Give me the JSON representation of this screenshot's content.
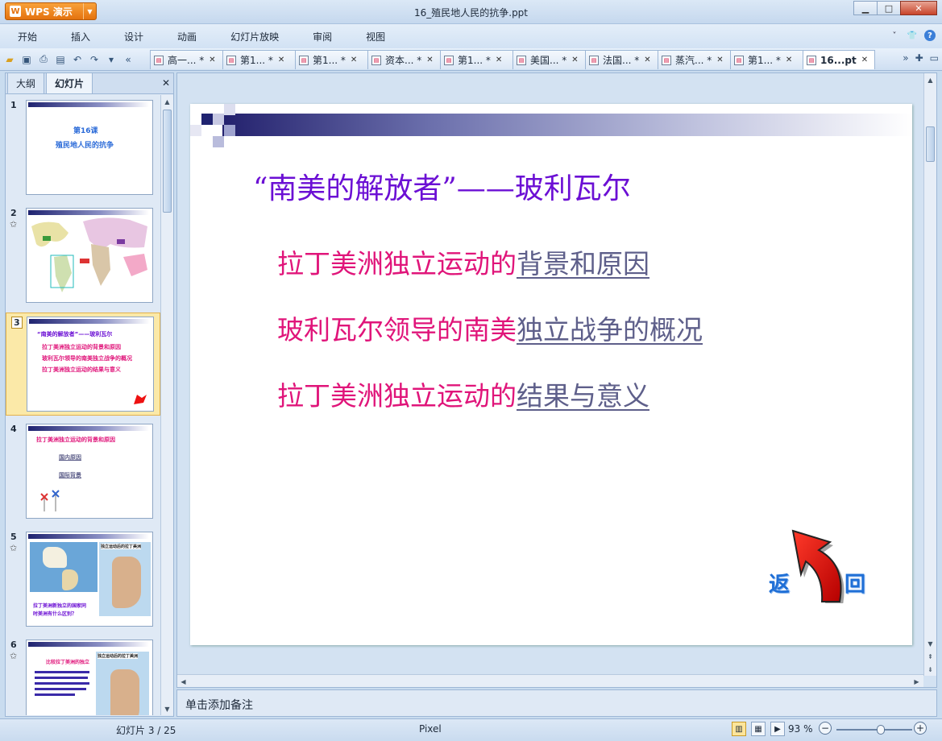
{
  "app": {
    "name": "WPS 演示",
    "window_title": "16_殖民地人民的抗争.ppt"
  },
  "menu": [
    "开始",
    "插入",
    "设计",
    "动画",
    "幻灯片放映",
    "审阅",
    "视图"
  ],
  "doc_tabs": [
    {
      "label": "高一... *",
      "active": false
    },
    {
      "label": "第1... *",
      "active": false
    },
    {
      "label": "第1... *",
      "active": false
    },
    {
      "label": "资本... *",
      "active": false
    },
    {
      "label": "第1... *",
      "active": false
    },
    {
      "label": "美国... *",
      "active": false
    },
    {
      "label": "法国... *",
      "active": false
    },
    {
      "label": "蒸汽... *",
      "active": false
    },
    {
      "label": "第1... *",
      "active": false
    },
    {
      "label": "16...pt",
      "active": true
    }
  ],
  "panel": {
    "tab_outline": "大纲",
    "tab_slides": "幻灯片"
  },
  "thumbnails": [
    {
      "num": "1",
      "lines": [
        "第16课",
        "殖民地人民的抗争"
      ]
    },
    {
      "num": "2",
      "lines": []
    },
    {
      "num": "3",
      "lines": [
        "“南美的解放者”——玻利瓦尔",
        "拉丁美洲独立运动的背景和原因",
        "玻利瓦尔领导的南美独立战争的概况",
        "拉丁美洲独立运动的结果与意义"
      ]
    },
    {
      "num": "4",
      "lines": [
        "拉丁美洲独立运动的背景和原因",
        "国内原因",
        "国际背景"
      ]
    },
    {
      "num": "5",
      "lines": [
        "独立运动后的拉丁美洲",
        "拉丁美洲新独立的国家同",
        "时美洲有什么区别？"
      ]
    },
    {
      "num": "6",
      "lines": [
        "比较拉丁美洲的独立",
        "独立运动后的拉丁美洲"
      ]
    }
  ],
  "slide": {
    "title": "“南美的解放者”——玻利瓦尔",
    "lines": [
      {
        "prefix": "拉丁美洲独立运动的",
        "link": "背景和原因"
      },
      {
        "prefix": "玻利瓦尔领导的南美",
        "link": "独立战争的概况"
      },
      {
        "prefix": "拉丁美洲独立运动的",
        "link": "结果与意义"
      }
    ],
    "return_left": "返",
    "return_right": "回"
  },
  "notes_placeholder": "单击添加备注",
  "status": {
    "slide_info": "幻灯片 3 / 25",
    "theme": "Pixel",
    "zoom": "93 %",
    "zoom_fraction": 0.58
  },
  "colors": {
    "title": "#6b0fd4",
    "body": "#e0157a",
    "link": "#5e5f8a",
    "accent": "#e4720e"
  }
}
